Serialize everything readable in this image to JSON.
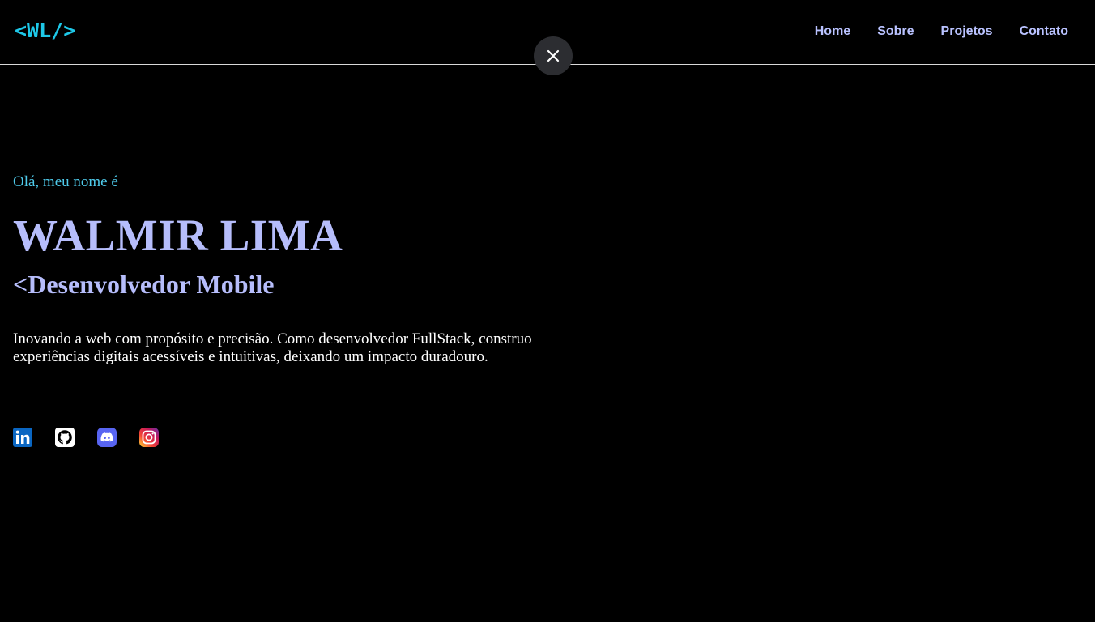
{
  "header": {
    "logo": "<WL/>",
    "nav": [
      {
        "label": "Home"
      },
      {
        "label": "Sobre"
      },
      {
        "label": "Projetos"
      },
      {
        "label": "Contato"
      }
    ]
  },
  "overlay": {
    "close_icon": "close-icon"
  },
  "hero": {
    "greeting": "Olá, meu nome é",
    "name": "WALMIR LIMA",
    "role": "<Desenvolvedor Mobile",
    "bio": "Inovando a web com propósito e precisão. Como desenvolvedor FullStack, construo experiências digitais acessíveis e intuitivas, deixando um impacto duradouro."
  },
  "socials": [
    {
      "icon": "linkedin-icon"
    },
    {
      "icon": "github-icon"
    },
    {
      "icon": "discord-icon"
    },
    {
      "icon": "instagram-icon"
    }
  ],
  "colors": {
    "background": "#000000",
    "accent_cyan": "#4ec9e9",
    "accent_lavender": "#b6bdfb",
    "text": "#ffffff"
  }
}
